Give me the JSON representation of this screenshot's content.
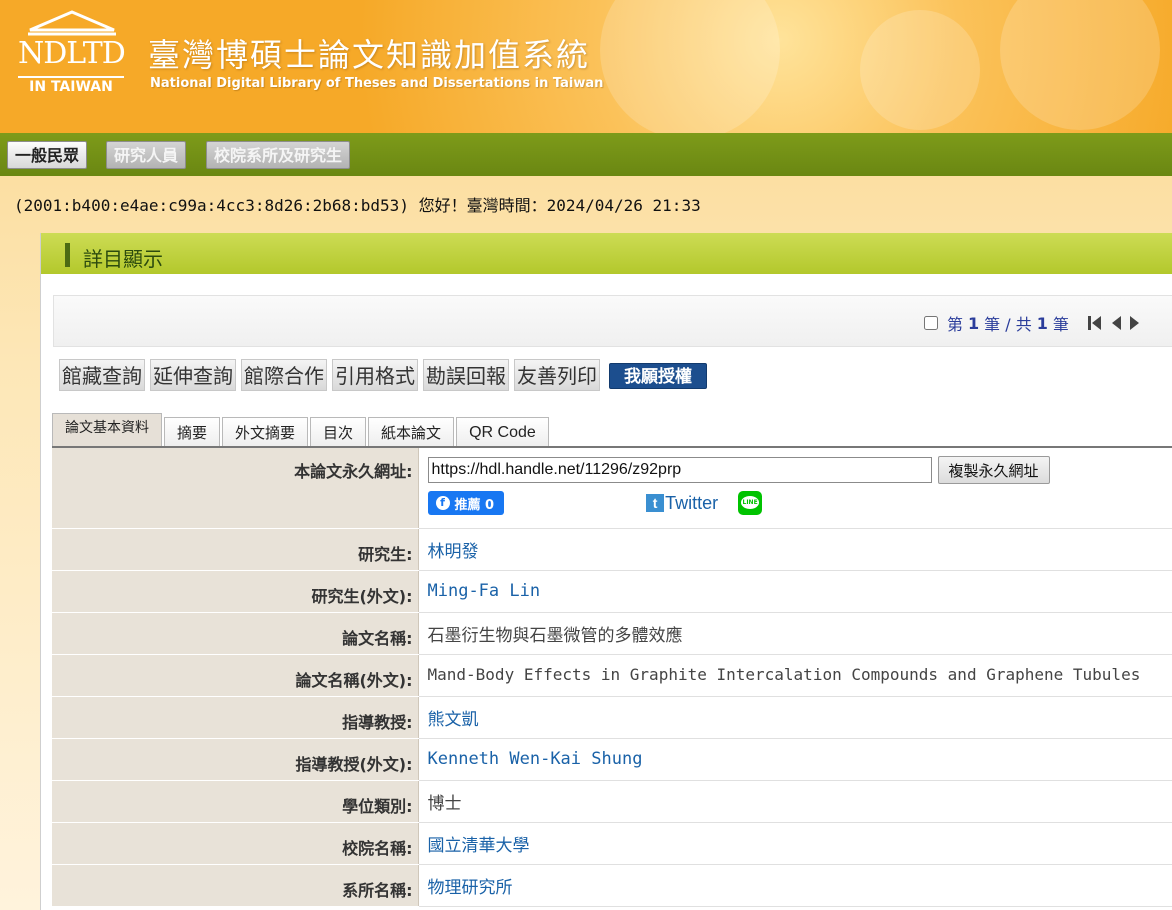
{
  "header": {
    "logo_text": "NDLTD",
    "logo_sub": "IN TAIWAN",
    "title": "臺灣博碩士論文知識加值系統",
    "subtitle": "National Digital Library of Theses and Dissertations in Taiwan"
  },
  "roles": [
    "一般民眾",
    "研究人員",
    "校院系所及研究生"
  ],
  "greeting": "(2001:b400:e4ae:c99a:4cc3:8d26:2b68:bd53) 您好！臺灣時間：2024/04/26 21:33",
  "panel": {
    "title": "詳目顯示",
    "pager": {
      "p1": "第",
      "current": "1",
      "p2": "筆 / 共",
      "total": "1",
      "p3": "筆"
    }
  },
  "tools": [
    "館藏查詢",
    "延伸查詢",
    "館際合作",
    "引用格式",
    "勘誤回報",
    "友善列印"
  ],
  "authorize_label": "我願授權",
  "tabs": [
    "論文基本資料",
    "摘要",
    "外文摘要",
    "目次",
    "紙本論文",
    "QR Code"
  ],
  "url_row": {
    "label": "本論文永久網址:",
    "value": "https://hdl.handle.net/11296/z92prp",
    "copy_label": "複製永久網址",
    "fb_label": "推薦 0",
    "twitter_label": "Twitter",
    "line_label": "LINE"
  },
  "fields": [
    {
      "label": "研究生:",
      "value": "林明發"
    },
    {
      "label": "研究生(外文):",
      "value": "Ming-Fa Lin"
    },
    {
      "label": "論文名稱:",
      "value": "石墨衍生物與石墨微管的多體效應"
    },
    {
      "label": "論文名稱(外文):",
      "value": "Mand-Body Effects in Graphite Intercalation Compounds and Graphene Tubules"
    },
    {
      "label": "指導教授:",
      "value": "熊文凱"
    },
    {
      "label": "指導教授(外文):",
      "value": "Kenneth Wen-Kai Shung"
    },
    {
      "label": "學位類別:",
      "value": "博士"
    },
    {
      "label": "校院名稱:",
      "value": "國立清華大學"
    },
    {
      "label": "系所名稱:",
      "value": "物理研究所"
    }
  ],
  "colors": {
    "accent_green": "#b3c82c",
    "link_blue": "#1a62a8",
    "authorize_blue": "#1c4e8e"
  }
}
